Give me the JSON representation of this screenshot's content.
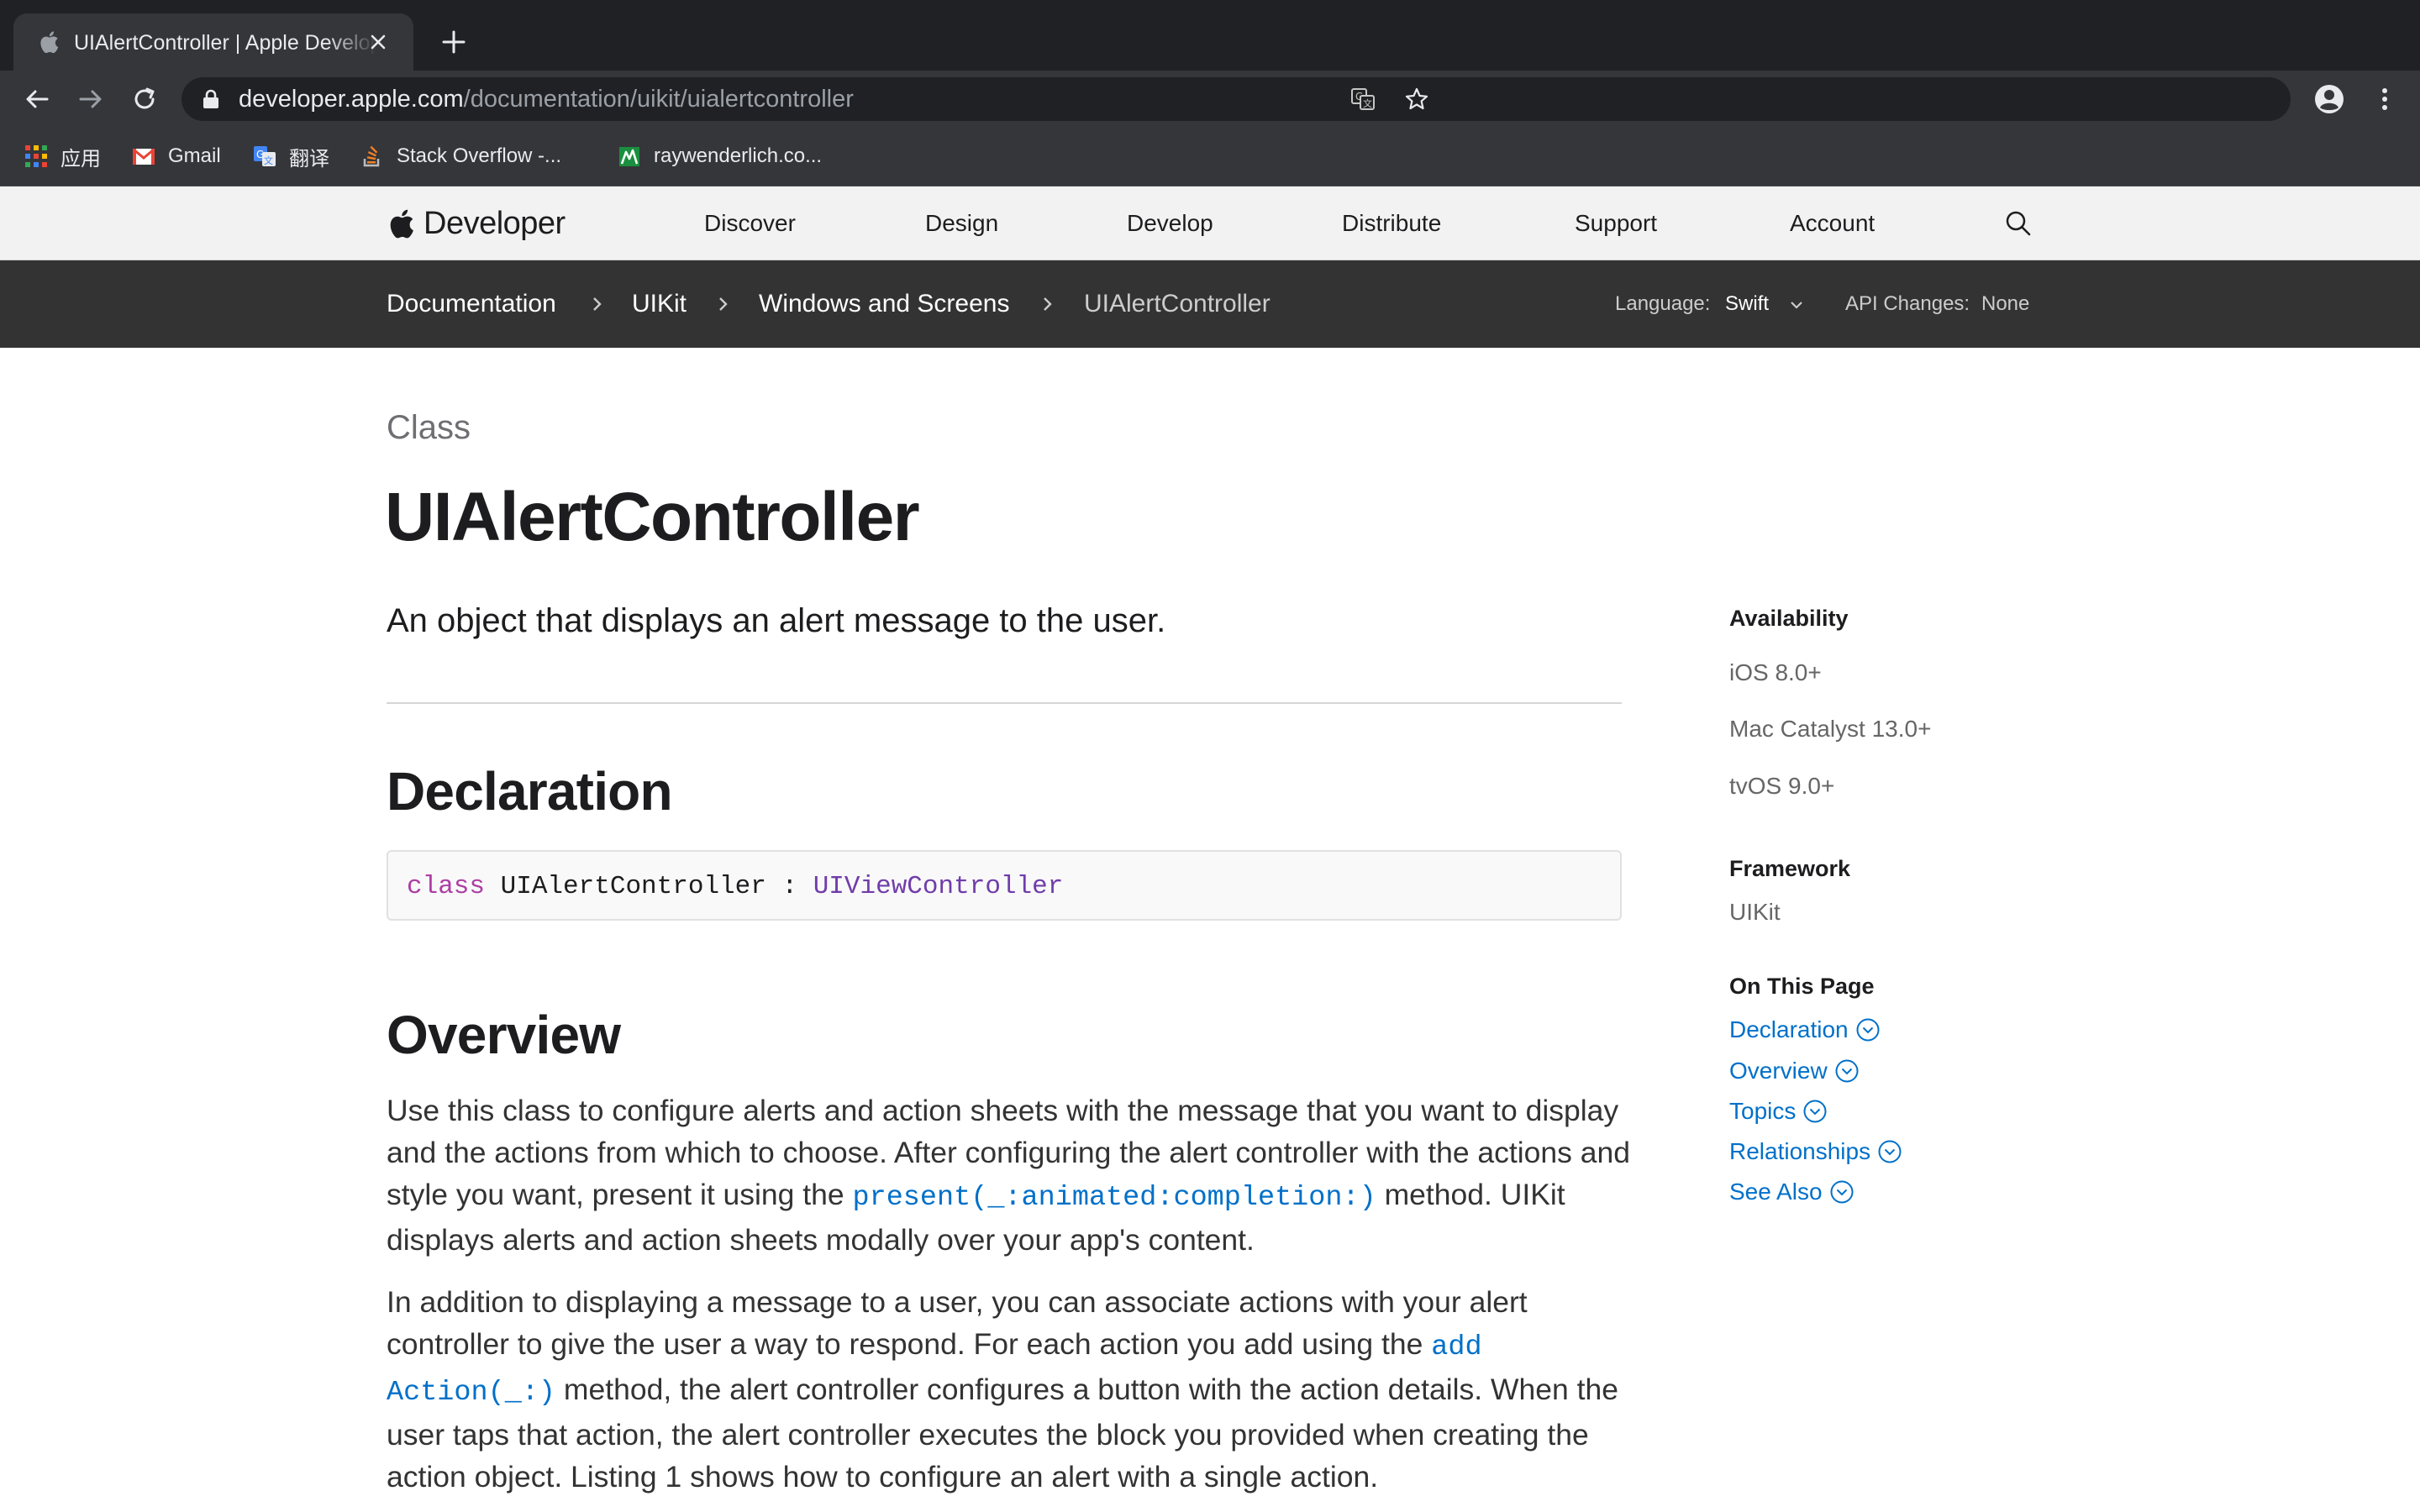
{
  "browser": {
    "tab": {
      "title": "UIAlertController | Apple Developer Documentation"
    },
    "omnibox": {
      "host": "developer.apple.com",
      "path": "/documentation/uikit/uialertcontroller"
    },
    "bookmarks": [
      {
        "label": "应用"
      },
      {
        "label": "Gmail"
      },
      {
        "label": "翻译"
      },
      {
        "label": "Stack Overflow -..."
      },
      {
        "label": "raywenderlich.co..."
      }
    ]
  },
  "globalnav": {
    "brand": "Developer",
    "links": [
      "Discover",
      "Design",
      "Develop",
      "Distribute",
      "Support",
      "Account"
    ]
  },
  "localnav": {
    "breadcrumbs": [
      "Documentation",
      "UIKit",
      "Windows and Screens",
      "UIAlertController"
    ],
    "language_label": "Language:",
    "language_value": "Swift",
    "api_label": "API Changes:",
    "api_value": "None"
  },
  "main": {
    "eyebrow": "Class",
    "title": "UIAlertController",
    "abstract": "An object that displays an alert message to the user.",
    "declaration": {
      "heading": "Declaration",
      "keyword": "class",
      "name": " UIAlertController : ",
      "superclass": "UIViewController"
    },
    "overview": {
      "heading": "Overview",
      "p1": {
        "l1": "Use this class to configure alerts and action sheets with the message that you want to display",
        "l2": "and the actions from which to choose. After configuring the alert controller with the actions and",
        "l3a": "style you want, present it using the ",
        "l3link": "present(_:animated:completion:)",
        "l3b": " method. UIKit",
        "l4": "displays alerts and action sheets modally over your app's content."
      },
      "p2": {
        "l1": "In addition to displaying a message to a user, you can associate actions with your alert",
        "l2a": "controller to give the user a way to respond. For each action you add using the ",
        "l2link": "add",
        "l3link": "Action(_:)",
        "l3b": " method, the alert controller configures a button with the action details. When the",
        "l4": "user taps that action, the alert controller executes the block you provided when creating the",
        "l5": "action object. Listing 1 shows how to configure an alert with a single action."
      }
    }
  },
  "sidebar": {
    "availability": {
      "heading": "Availability",
      "items": [
        "iOS 8.0+",
        "Mac Catalyst 13.0+",
        "tvOS 9.0+"
      ]
    },
    "framework": {
      "heading": "Framework",
      "value": "UIKit"
    },
    "on_this_page": {
      "heading": "On This Page",
      "links": [
        "Declaration",
        "Overview",
        "Topics",
        "Relationships",
        "See Also"
      ]
    }
  },
  "colors": {
    "link": "#0070c9",
    "keyword": "#ad3da4",
    "type": "#703daa",
    "chrome_dark": "#202124",
    "chrome_toolbar": "#35363a",
    "localnav": "#333333"
  }
}
